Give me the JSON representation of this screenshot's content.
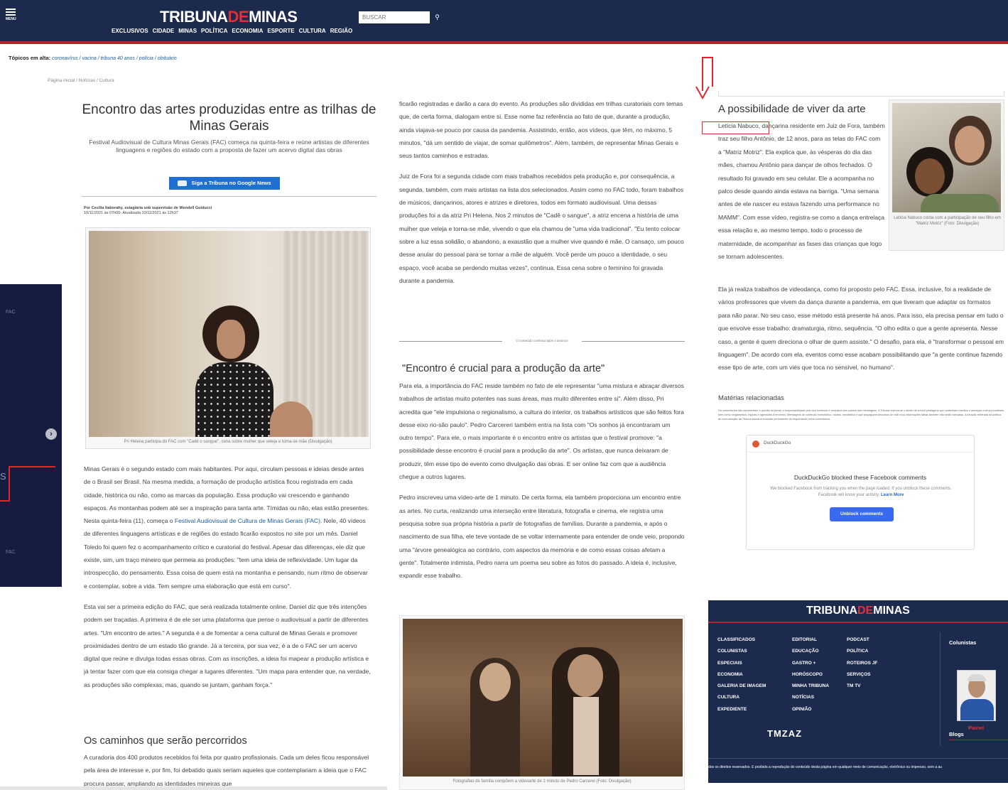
{
  "header": {
    "menu_label": "MENU",
    "logo_part1": "TRIBUNA",
    "logo_part2": "DE",
    "logo_part3": "MINAS",
    "nav": [
      "EXCLUSIVOS",
      "CIDADE",
      "MINAS",
      "POLÍTICA",
      "ECONOMIA",
      "ESPORTE",
      "CULTURA",
      "REGIÃO"
    ],
    "search_placeholder": "BUSCAR"
  },
  "trending": {
    "label": "Tópicos em alta:",
    "topics": "coronavírus / vacina / tribuna 40 anos / polícia / obituário"
  },
  "breadcrumb": "Página inicial /  Notícias /  Cultura",
  "article": {
    "title": "Encontro das artes produzidas entre as trilhas de Minas Gerais",
    "subtitle": "Festival Audiovisual de Cultura Minas Gerais (FAC) começa na quinta-feira e reúne artistas de diferentes linguagens e regiões do estado com a proposta de fazer um acervo digital das obras",
    "gnews_label": "Siga a Tribuna no Google News",
    "byline1": "Por Cecília Itaborahy, estagiária sob supervisão de Wendell Guiducci",
    "byline2": "10/11/2021 às 07h00- Atualizada 10/11/2021 às 12h37",
    "fig1_caption": "Pri Helena participa do FAC com \"Cadê o sangue\", cena sobre mulher que veleja e torna-se mãe (Divulgação)",
    "c1_p1a": "Minas Gerais é o segundo estado com mais habitantes. Por aqui, circulam pessoas e ideias desde antes de o Brasil ser Brasil. Na mesma medida, a formação de produção artística ficou registrada em cada cidade, histórica ou não, como as marcas da população. Essa produção vai crescendo e ganhando espaços. As montanhas podem até ser a inspiração para tanta arte. Tímidas ou não, elas estão presentes. Nesta quinta-feira (11), começa o ",
    "c1_p1_link": "Festival Audiovisual de Cultura de Minas Gerais (FAC)",
    "c1_p1b": ". Nele, 40 vídeos de diferentes linguagens artísticas e de regiões do estado ficarão expostos no site por um mês. Daniel Toledo foi quem fez o acompanhamento crítico e curatorial do festival. Apesar das diferenças, ele diz que existe, sim, um traço mineiro que permeia as produções: \"tem uma ideia de reflexividade. Um lugar da introspecção, do pensamento. Essa coisa de quem está na montanha e pensando, num ritmo de observar e contemplar, sobre a vida. Tem sempre uma elaboração que está em curso\".",
    "c1_p2": "Esta vai ser a primeira edição do FAC, que será realizada totalmente online. Daniel diz que três intenções podem ser traçadas. A primeira é de ele ser uma plataforma que pense o audiovisual a partir de diferentes artes. \"Um encontro de artes.\" A segunda é a de fomentar a cena cultural de Minas Gerais e promover proximidades dentro de um estado tão grande. Já a terceira, por sua vez, é a de o FAC ser um acervo digital que reúne e divulga todas essas obras. Com as inscrições, a ideia foi mapear a produção artística e já tentar fazer com que ela consiga chegar a lugares diferentes. \"Um mapa para entender que, na verdade, as produções são complexas, mas, quando se juntam, ganham força.\"",
    "h2_caminhos": "Os caminhos que serão percorridos",
    "c1_p3": "A curadoria dos 400 produtos recebidos foi feita por quatro profissionais. Cada um deles ficou responsável pela área de interesse e, por fim, foi debatido quais seriam aqueles que contemplariam a ideia que o FAC procura passar, ampliando as identidades mineiras que",
    "c2_p1": "ficarão registradas e darão a cara do evento. As produções são divididas em trilhas curatoriais com temas que, de certa forma, dialogam entre si. Esse nome faz referência ao fato de que, durante a produção, ainda viajava-se pouco por causa da pandemia. Assistindo, então, aos vídeos, que têm, no máximo, 5 minutos, \"dá um sentido de viajar, de somar quilômetros\". Além, também, de representar Minas Gerais e seus tantos caminhos e estradas.",
    "c2_p2": "Juiz de Fora foi a segunda cidade com mais trabalhos recebidos pela produção e, por consequência, a segunda, também, com mais artistas na lista dos selecionados. Assim como no FAC todo, foram trabalhos de músicos, dançarinos, atores e atrizes e diretores, todos em formato audiovisual. Uma dessas produções foi a da atriz Pri Helena. Nos 2 minutos de \"Cadê o sangue\", a atriz encena a história de uma mulher que veleja e torna-se mãe, vivendo o que ela chamou de \"uma vida tradicional\". \"Eu tento colocar sobre a luz essa solidão, o abandono, a exaustão que a mulher vive quando é mãe. O cansaço, um pouco desse anular do pessoal para se tornar a mãe de alguém. Você perde um pouco a identidade, o seu espaço, você acaba se perdendo muitas vezes\", continua. Essa cena sobre o feminino foi gravada durante a pandemia.",
    "ad_note": "O conteúdo continua após o anúncio",
    "h2_encontro": "\"Encontro é crucial para a produção da arte\"",
    "c2_p3": "Para ela, a importância do FAC reside também no fato de ele representar \"uma mistura e abraçar diversos trabalhos de artistas muito potentes nas suas áreas, mas muito diferentes entre si\". Além disso, Pri acredita que \"ele impulsiona o regionalismo, a cultura do interior, os trabalhos artísticos que são feitos fora desse eixo rio-são paulo\". Pedro Carcereri também entra na lista com \"Os sonhos já encontraram um outro tempo\". Para ele, o mais importante é o encontro entre os artistas que o festival promove: \"a possibilidade desse encontro é crucial para a produção da arte\". Os artistas, que nunca deixaram de produzir, têm esse tipo de evento como divulgação das obras. E ser online faz com que a audiência chegue a outros lugares.",
    "c2_p4": "Pedro inscreveu uma vídeo-arte de 1 minuto. De certa forma, ela também proporciona um encontro entre as artes. No curta, realizando uma interseção entre literatura, fotografia e cinema, ele registra uma pesquisa sobre sua própria história a partir de fotografias de famílias. Durante a pandemia, e após o nascimento de sua filha, ele teve vontade de se voltar internamente para entender de onde veio, propondo uma \"árvore genealógica ao contrário, com aspectos da memória e de como essas coisas afetam a gente\". Totalmente intimista, Pedro narra um poema seu sobre as fotos do passado. A ideia é, inclusive, expandir esse trabalho.",
    "fig2_caption": "Fotografias de família compõem a videoarte de 1 minuto de Pedro Carcerei (Foto: Divulgação)"
  },
  "right_col": {
    "title": "A possibilidade de viver da arte",
    "p1": "Letícia Nabuco, dançarina residente em Juiz de Fora, também traz seu filho Antônio, de 12 anos, para as telas do FAC com a \"Matriz Motriz\". Ela explica que, às vésperas do dia das mães, chamou Antônio para dançar de olhos fechados. O resultado foi gravado em seu celular. Ele a acompanha no palco desde quando ainda estava na barriga. \"Uma semana antes de ele nascer eu estava fazendo uma performance no MAMM\". Com esse vídeo, registra-se como a dança entrelaça essa relação e, ao mesmo tempo, todo o processo de maternidade, de acompanhar as fases das crianças que logo se tornam adolescentes.",
    "fig_caption": "Letícia Nabuco conta com a participação de seu filho em \"Matriz Motriz\" (Foto: Divulgação)",
    "p2": "Ela já realiza trabalhos de videodança, como foi proposto pelo FAC. Essa, inclusive, foi a realidade de vários professores que vivem da dança durante a pandemia, em que tiveram que adaptar os formatos para não parar. No seu caso, esse método está presente há anos. Para isso, ela precisa pensar em tudo o que envolve esse trabalho: dramaturgia, ritmo, sequência. \"O olho edita o que a gente apresenta. Nesse caso, a gente é quem direciona o olhar de quem assiste.\" O desafio, para ela, é \"transformar o pessoal em linguagem\". De acordo com ela, eventos como esse acabam possibilitando que \"a gente continue fazendo esse tipo de arte, com um viés que toca no sensível, no humano\".",
    "related": "Matérias relacionadas",
    "disclaimer": "Os comentários não representam a opinião do jornal; a responsabilidade pelo seu conteúdo é exclusiva dos autores das mensagens. A Tribuna reserva-se o direito de excluir postagens que contenham insultos e ameaças a seus jornalistas, bem como xingamentos, injúrias e agressões a terceiros. Mensagens de conteúdo homofóbico, racista, xenofóbico e que propaguem discursos de ódio e/ou informações falsas também não serão toleradas. A infração reiterada da política de comunicação da Tribuna levará à exclusão permanente do responsável pelos comentários."
  },
  "ddg": {
    "name": "DuckDuckGo",
    "title": "DuckDuckGo blocked these Facebook comments",
    "desc": "We blocked Facebook from tracking you when the page loaded. If you unblock these comments, Facebook will know your activity. ",
    "learn_more": "Learn More",
    "button": "Unblock comments"
  },
  "footer": {
    "logo_part1": "TRIBUNA",
    "logo_part2": "DE",
    "logo_part3": "MINAS",
    "col1": [
      "CLASSIFICADOS",
      "COLUNISTAS",
      "ESPECIAIS",
      "ECONOMIA",
      "GALERIA DE IMAGEM",
      "CULTURA",
      "EXPEDIENTE"
    ],
    "col2": [
      "EDITORIAL",
      "EDUCAÇÃO",
      "GASTRO +",
      "HORÓSCOPO",
      "MINHA TRIBUNA",
      "NOTÍCIAS",
      "OPINIÃO"
    ],
    "col3": [
      "PODCAST",
      "POLÍTICA",
      "ROTEIROS JF",
      "SERVIÇOS",
      "TM TV"
    ],
    "colunistas": "Colunistas",
    "painel": "Painel",
    "blogs": "Blogs",
    "brand": "TMZAZ",
    "copyright": "dos os direitos reservados. É proibida a reprodução do conteúdo desta página em qualquer meio de comunicação, eletrônico ou impresso, sem a au"
  },
  "overlay": {
    "fac_top": "FAC",
    "fac_bottom": "FAC",
    "next_icon": "›",
    "letter": "S"
  }
}
